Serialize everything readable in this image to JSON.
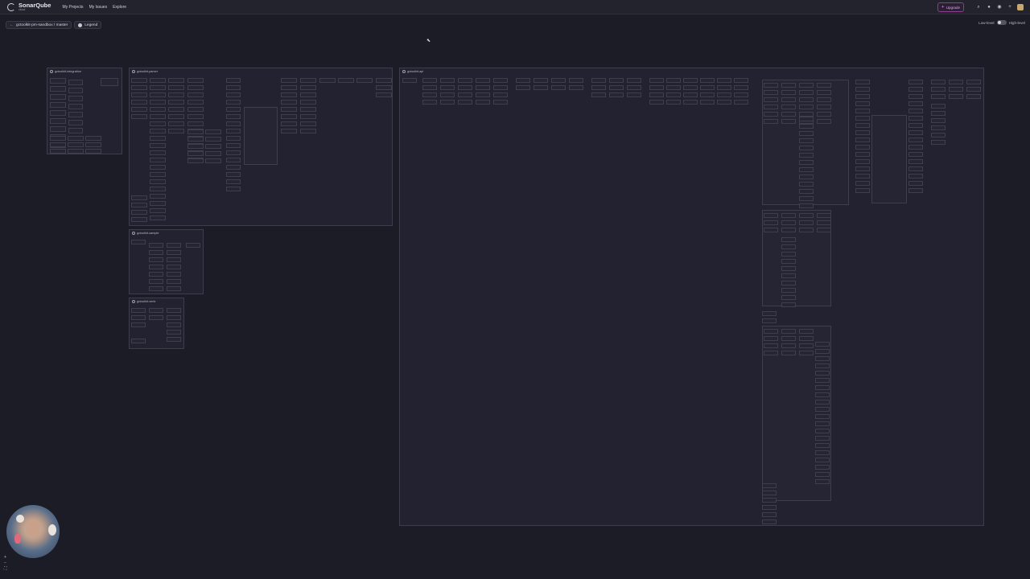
{
  "header": {
    "logo_name": "SonarQube",
    "logo_sub": "cloud",
    "nav": [
      "My Projects",
      "My Issues",
      "Explore"
    ],
    "upgrade_label": "Upgrade"
  },
  "subbar": {
    "project": "gctoolkit-pm-sandbox / master",
    "legend": "Legend"
  },
  "toggle": {
    "low": "Low-level",
    "high": "High-level"
  },
  "modules": [
    {
      "key": "integration",
      "name": "gctoolkit-integration"
    },
    {
      "key": "parser",
      "name": "gctoolkit-parser"
    },
    {
      "key": "api",
      "name": "gctoolkit-api"
    },
    {
      "key": "sample",
      "name": "gctoolkit-sample"
    },
    {
      "key": "vertx",
      "name": "gctoolkit-vertx"
    }
  ],
  "zoom": {
    "in": "+",
    "out": "−",
    "fit": "⛶"
  },
  "colors": {
    "background": "#1c1c27",
    "module_border": "#3d3d4b",
    "upgrade_accent": "#8a3f8f"
  }
}
